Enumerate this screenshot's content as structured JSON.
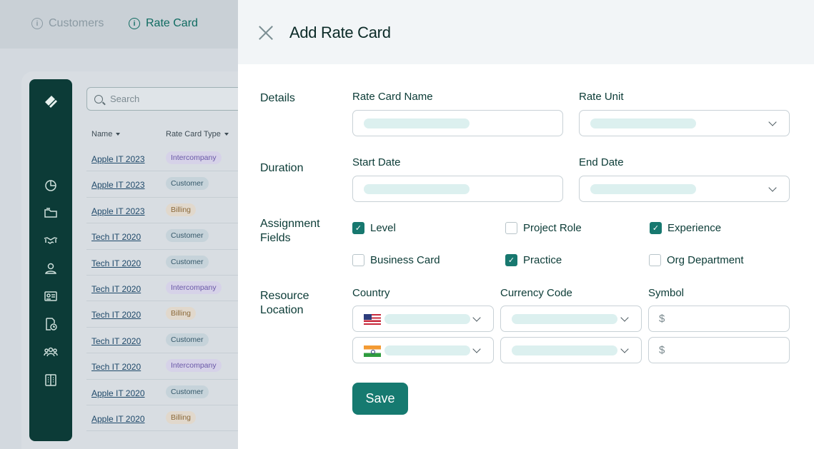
{
  "tabs": [
    {
      "label": "Customers",
      "active": false
    },
    {
      "label": "Rate Card",
      "active": true
    }
  ],
  "search": {
    "placeholder": "Search"
  },
  "table": {
    "headers": [
      "Name",
      "Rate Card Type"
    ],
    "rows": [
      {
        "name": "Apple IT 2023",
        "type": "Intercompany"
      },
      {
        "name": "Apple IT 2023",
        "type": "Customer"
      },
      {
        "name": "Apple IT 2023",
        "type": "Billing"
      },
      {
        "name": "Tech IT 2020",
        "type": "Customer"
      },
      {
        "name": "Tech IT 2020",
        "type": "Customer"
      },
      {
        "name": "Tech IT 2020",
        "type": "Intercompany"
      },
      {
        "name": "Tech IT 2020",
        "type": "Billing"
      },
      {
        "name": "Tech IT 2020",
        "type": "Customer"
      },
      {
        "name": "Tech IT 2020",
        "type": "Intercompany"
      },
      {
        "name": "Apple IT 2020",
        "type": "Customer"
      },
      {
        "name": "Apple IT 2020",
        "type": "Billing"
      }
    ]
  },
  "sidebar_icons": [
    "dashboard-icon",
    "folder-icon",
    "handshake-icon",
    "user-icon",
    "id-card-icon",
    "document-clock-icon",
    "team-icon",
    "building-icon"
  ],
  "modal": {
    "title": "Add Rate Card",
    "sections": {
      "details": "Details",
      "duration": "Duration",
      "assignment": "Assignment Fields",
      "resource": "Resource Location"
    },
    "labels": {
      "rate_card_name": "Rate Card Name",
      "rate_unit": "Rate Unit",
      "start_date": "Start Date",
      "end_date": "End Date",
      "country": "Country",
      "currency_code": "Currency Code",
      "symbol": "Symbol"
    },
    "assignment_fields": [
      {
        "label": "Level",
        "checked": true
      },
      {
        "label": "Project Role",
        "checked": false
      },
      {
        "label": "Experience",
        "checked": true
      },
      {
        "label": "Business Card",
        "checked": false
      },
      {
        "label": "Practice",
        "checked": true
      },
      {
        "label": "Org Department",
        "checked": false
      }
    ],
    "locations": [
      {
        "flag": "us-flag-icon",
        "symbol": "$"
      },
      {
        "flag": "india-flag-icon",
        "symbol": "$"
      }
    ],
    "save_label": "Save"
  },
  "colors": {
    "accent": "#167a70",
    "sidebar": "#0c3b37",
    "placeholder": "#dcf0ef"
  }
}
